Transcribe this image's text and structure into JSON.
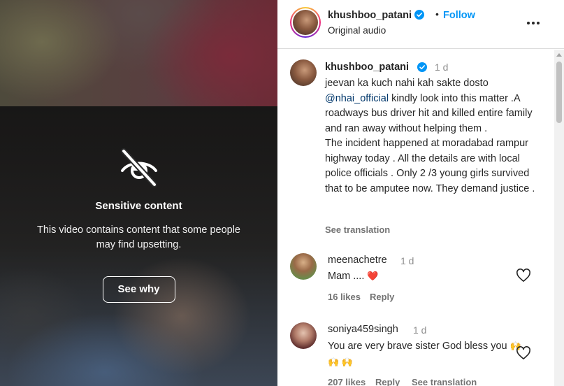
{
  "media": {
    "sensitive_title": "Sensitive content",
    "sensitive_description": "This video contains content that some people may find upsetting.",
    "see_why_label": "See why",
    "icon": "eye-slash-icon"
  },
  "header": {
    "username": "khushboo_patani",
    "separator": "•",
    "follow_label": "Follow",
    "subtitle": "Original audio",
    "more_icon": "more-options-icon",
    "verified_color": "#0095f6"
  },
  "caption": {
    "username": "khushboo_patani",
    "time": "1 d",
    "text_before_mention": "jeevan ka kuch nahi kah sakte dosto ",
    "mention": "@nhai_official",
    "text_after_mention": " kindly look into this matter .A roadways bus driver hit and killed entire family and ran away without helping them .",
    "text_second": "The incident happened at moradabad rampur highway today . All the details are with local police officials . Only 2 /3 young girls survived that to be amputee now. They demand justice .",
    "see_translation": "See translation"
  },
  "comments": [
    {
      "username": "meenachetre",
      "time": "1 d",
      "text": "Mam ....",
      "emoji": "❤️",
      "likes": "16 likes",
      "reply": "Reply"
    },
    {
      "username": "soniya459singh",
      "time": "1 d",
      "text": "You are very brave sister God bless you",
      "emoji": "🙌 🙌 🙌",
      "likes": "207 likes",
      "reply": "Reply",
      "see_translation": "See translation"
    }
  ],
  "colors": {
    "accent": "#0095f6",
    "mention": "#00376b",
    "muted": "#8e8e8e",
    "heart_emoji": "#e0245e"
  }
}
